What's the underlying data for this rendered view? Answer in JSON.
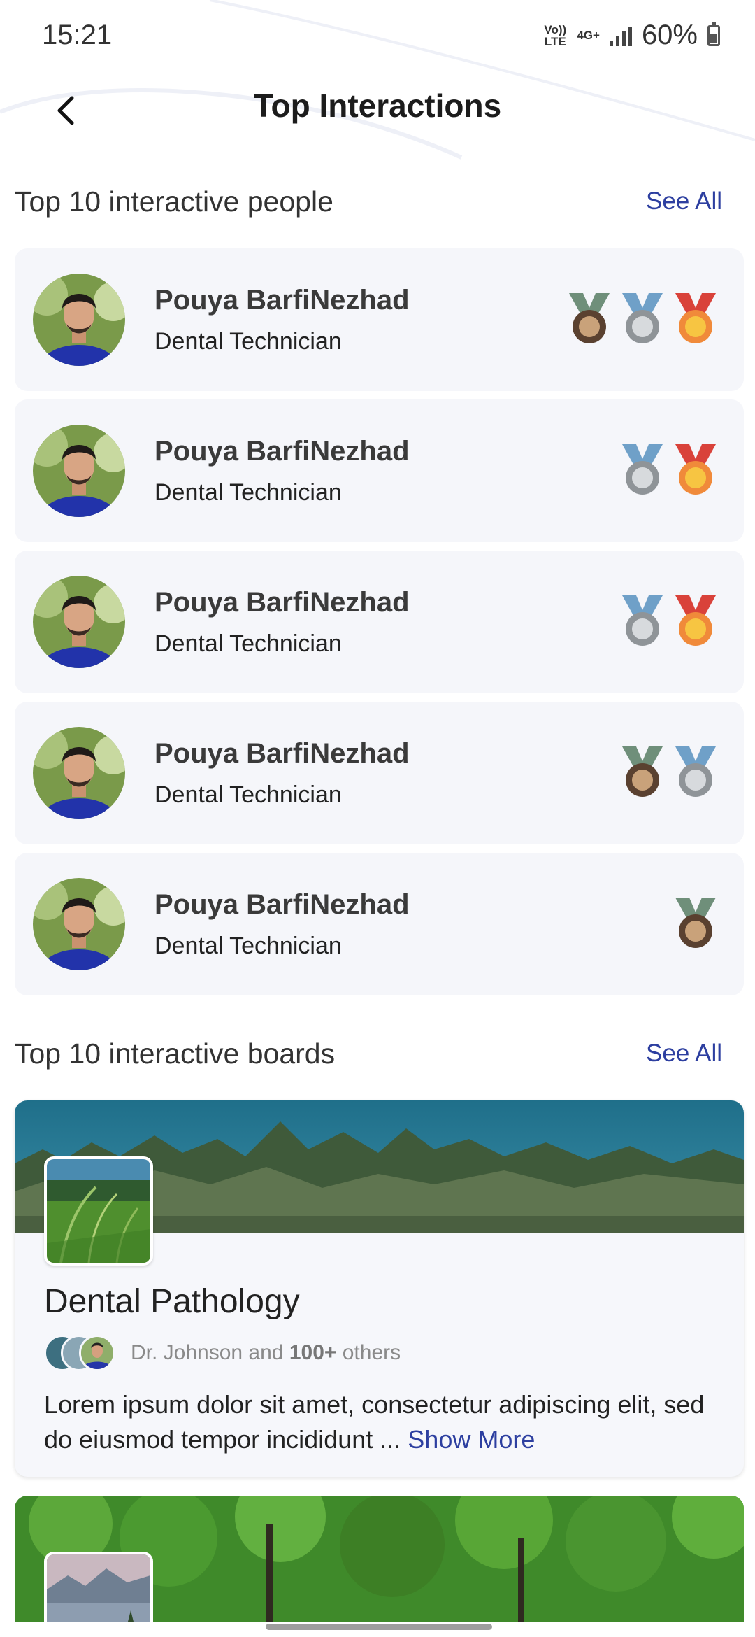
{
  "status_bar": {
    "time": "15:21",
    "network_1": "Vo)) LTE",
    "network_2": "4G+",
    "battery": "60%"
  },
  "header": {
    "title": "Top Interactions",
    "back_icon": "back-chevron-icon"
  },
  "people_section": {
    "title": "Top 10 interactive people",
    "see_all": "See All",
    "people": [
      {
        "name": "Pouya BarfiNezhad",
        "role": "Dental Technician",
        "medals": [
          "bronze",
          "silver",
          "gold"
        ]
      },
      {
        "name": "Pouya BarfiNezhad",
        "role": "Dental Technician",
        "medals": [
          "silver",
          "gold"
        ]
      },
      {
        "name": "Pouya BarfiNezhad",
        "role": "Dental Technician",
        "medals": [
          "silver",
          "gold"
        ]
      },
      {
        "name": "Pouya BarfiNezhad",
        "role": "Dental Technician",
        "medals": [
          "bronze",
          "silver"
        ]
      },
      {
        "name": "Pouya BarfiNezhad",
        "role": "Dental Technician",
        "medals": [
          "bronze"
        ]
      }
    ]
  },
  "boards_section": {
    "title": "Top 10 interactive boards",
    "see_all": "See All",
    "boards": [
      {
        "title": "Dental Pathology",
        "members_lead": "Dr. Johnson and",
        "members_count": "100+",
        "members_tail": "others",
        "description": "Lorem ipsum dolor sit amet, consectetur adipiscing elit, sed do eiusmod tempor incididunt ...",
        "show_more": "Show More"
      }
    ]
  },
  "colors": {
    "accent": "#2d3fa0",
    "card_bg": "#f5f6fa",
    "gold": "#f5a623",
    "silver": "#9ea2a6",
    "bronze": "#8a6a4a"
  }
}
